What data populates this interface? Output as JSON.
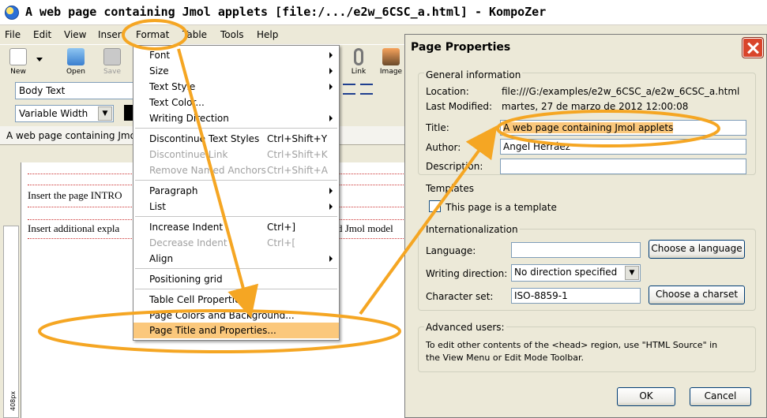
{
  "window": {
    "title": "A web page containing Jmol applets [file:/.../e2w_6CSC_a.html] - KompoZer"
  },
  "menubar": [
    "File",
    "Edit",
    "View",
    "Insert",
    "Format",
    "Table",
    "Tools",
    "Help"
  ],
  "toolbar": {
    "new": "New",
    "open": "Open",
    "save": "Save",
    "link": "Link",
    "image": "Image"
  },
  "format_bar": {
    "paragraph_style": "Body Text",
    "font_width": "Variable Width"
  },
  "document": {
    "tab_title": "A web page containing Jmol a",
    "line1": "Insert the page INTRO",
    "line2": "Insert additional expla",
    "line2_tail": "d Jmol model",
    "ruler_label": "408px"
  },
  "format_menu": {
    "items": [
      {
        "label": "Font",
        "submenu": true
      },
      {
        "label": "Size",
        "submenu": true
      },
      {
        "label": "Text Style",
        "submenu": true
      },
      {
        "label": "Text Color...",
        "submenu": false
      },
      {
        "label": "Writing Direction",
        "submenu": true
      },
      {
        "label": "Discontinue Text Styles",
        "shortcut": "Ctrl+Shift+Y"
      },
      {
        "label": "Discontinue Link",
        "shortcut": "Ctrl+Shift+K",
        "disabled": true
      },
      {
        "label": "Remove Named Anchors",
        "shortcut": "Ctrl+Shift+A",
        "disabled": true
      },
      {
        "label": "Paragraph",
        "submenu": true
      },
      {
        "label": "List",
        "submenu": true
      },
      {
        "label": "Increase Indent",
        "shortcut": "Ctrl+]"
      },
      {
        "label": "Decrease Indent",
        "shortcut": "Ctrl+[",
        "disabled": true
      },
      {
        "label": "Align",
        "submenu": true
      },
      {
        "label": "Positioning grid"
      },
      {
        "label": "Table Cell Properties..."
      },
      {
        "label": "Page Colors and Background..."
      },
      {
        "label": "Page Title and Properties...",
        "selected": true
      }
    ]
  },
  "dialog": {
    "title": "Page Properties",
    "general": {
      "heading": "General information",
      "location_label": "Location:",
      "location_value": "file:///G:/examples/e2w_6CSC_a/e2w_6CSC_a.html",
      "modified_label": "Last Modified:",
      "modified_value": "martes, 27 de marzo de 2012 12:00:08",
      "title_label": "Title:",
      "title_value": "A web page containing Jmol applets",
      "author_label": "Author:",
      "author_value": "Angel Herráez",
      "description_label": "Description:",
      "description_value": ""
    },
    "templates": {
      "heading": "Templates",
      "checkbox_label": "This page is a template"
    },
    "i18n": {
      "heading": "Internationalization",
      "language_label": "Language:",
      "language_value": "",
      "choose_language": "Choose a language",
      "direction_label": "Writing direction:",
      "direction_value": "No direction specified",
      "charset_label": "Character set:",
      "charset_value": "ISO-8859-1",
      "choose_charset": "Choose a charset"
    },
    "advanced": {
      "heading": "Advanced users:",
      "text1": "To edit other contents of the <head> region, use \"HTML Source\" in",
      "text2": "the View Menu or Edit Mode Toolbar."
    },
    "ok": "OK",
    "cancel": "Cancel"
  },
  "colors": {
    "annotation": "#f5a623",
    "highlight": "#fbc87c",
    "close_button": "#d9452b"
  }
}
